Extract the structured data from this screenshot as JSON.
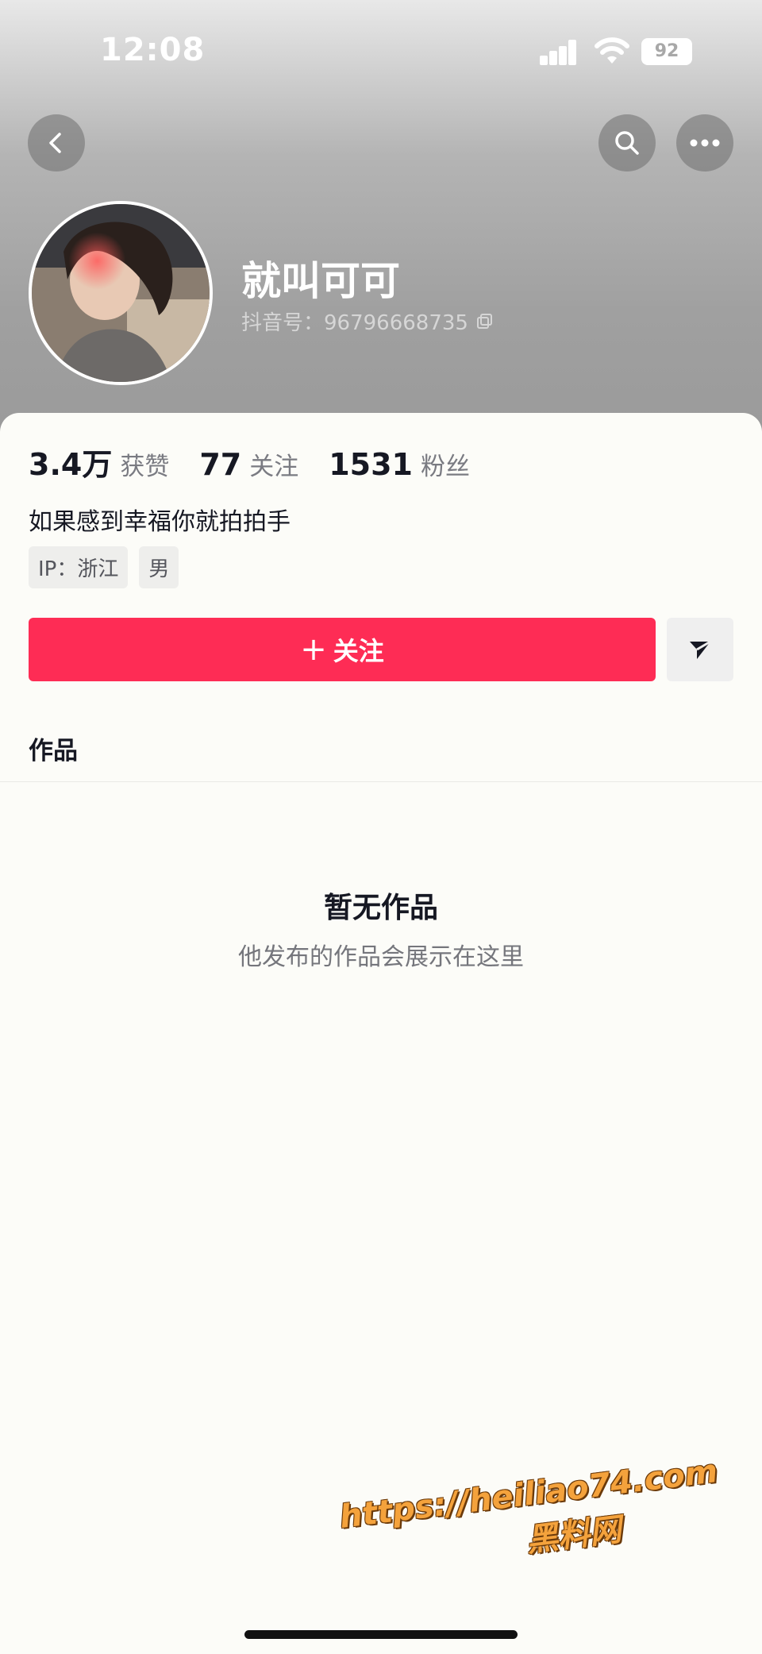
{
  "status_bar": {
    "time": "12:08",
    "battery": "92"
  },
  "profile": {
    "name": "就叫可可",
    "douyin_id": "抖音号：96796668735",
    "avatar_icon": "avatar-photo"
  },
  "stats": [
    {
      "value": "3.4万",
      "label": "获赞"
    },
    {
      "value": "77",
      "label": "关注"
    },
    {
      "value": "1531",
      "label": "粉丝"
    }
  ],
  "bio": "如果感到幸福你就拍拍手",
  "tags": [
    "IP：浙江",
    "男"
  ],
  "actions": {
    "follow_plus": "+",
    "follow_label": "关注",
    "share_icon": "send-icon"
  },
  "tabs": [
    "作品"
  ],
  "empty": {
    "title": "暂无作品",
    "subtitle": "他发布的作品会展示在这里"
  },
  "watermark": {
    "url": "https://heiliao74.com",
    "name": "黑料网"
  },
  "colors": {
    "accent": "#fe2c55",
    "background": "#fcfcf8"
  }
}
